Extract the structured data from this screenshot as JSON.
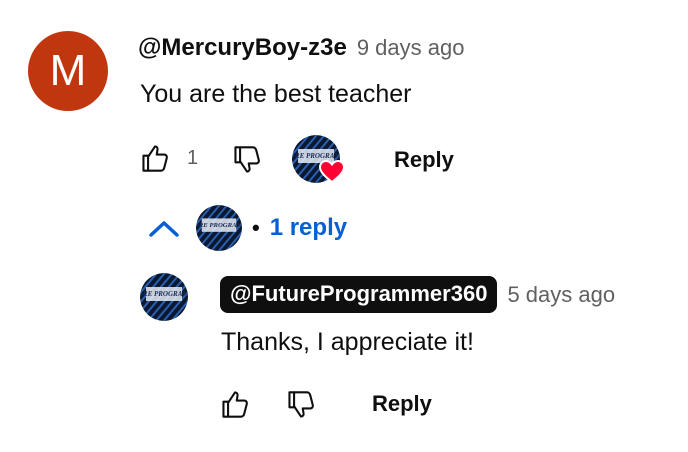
{
  "comment": {
    "avatar_letter": "M",
    "author": "@MercuryBoy-z3e",
    "time": "9 days ago",
    "text": "You are the best teacher",
    "like_count": "1",
    "reply_label": "Reply",
    "heart_color": "#ff0033"
  },
  "replies_toggle": {
    "separator": "•",
    "label": "1 reply"
  },
  "reply": {
    "author": "@FutureProgrammer360",
    "time": "5 days ago",
    "text": "Thanks, I appreciate it!",
    "reply_label": "Reply"
  },
  "channel_logo_text": "FUTURE PROGRAMMER",
  "colors": {
    "link": "#065fd4",
    "avatar_bg": "#c0360f"
  }
}
